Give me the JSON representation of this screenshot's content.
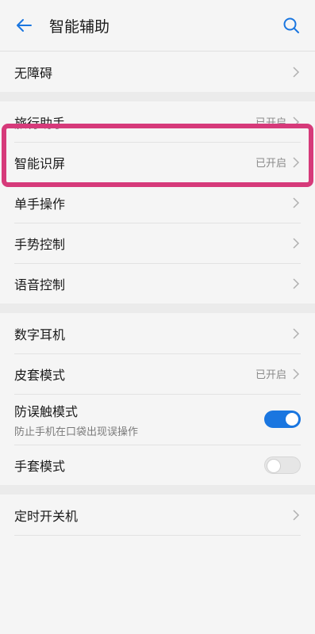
{
  "header": {
    "title": "智能辅助"
  },
  "colors": {
    "accent": "#1a76e0",
    "highlight": "#d63a7a"
  },
  "groups": [
    {
      "items": [
        {
          "label": "无障碍",
          "status": ""
        }
      ]
    },
    {
      "items": [
        {
          "label": "旅行助手",
          "status": "已开启"
        },
        {
          "label": "智能识屏",
          "status": "已开启"
        },
        {
          "label": "单手操作",
          "status": ""
        },
        {
          "label": "手势控制",
          "status": ""
        },
        {
          "label": "语音控制",
          "status": ""
        }
      ]
    },
    {
      "items": [
        {
          "label": "数字耳机",
          "status": ""
        },
        {
          "label": "皮套模式",
          "status": "已开启"
        },
        {
          "label": "防误触模式",
          "sub": "防止手机在口袋出现误操作",
          "toggle": true,
          "on": true
        },
        {
          "label": "手套模式",
          "toggle": true,
          "on": false
        }
      ]
    },
    {
      "items": [
        {
          "label": "定时开关机",
          "status": ""
        }
      ]
    }
  ]
}
